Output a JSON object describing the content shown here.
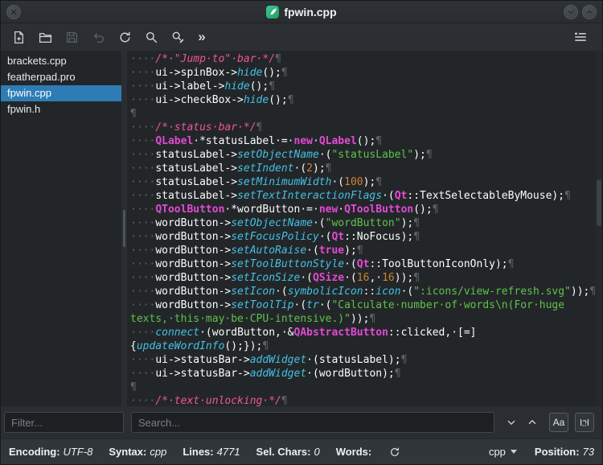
{
  "window": {
    "title": "fpwin.cpp"
  },
  "toolbar": {
    "overflow_label": "»"
  },
  "sidebar": {
    "files": [
      "brackets.cpp",
      "featherpad.pro",
      "fpwin.cpp",
      "fpwin.h"
    ],
    "selected_index": 2,
    "filter_placeholder": "Filter..."
  },
  "search": {
    "placeholder": "Search...",
    "match_case_label": "Aa"
  },
  "statusbar": {
    "encoding_label": "Encoding:",
    "encoding_value": "UTF-8",
    "syntax_label": "Syntax:",
    "syntax_value": "cpp",
    "lines_label": "Lines:",
    "lines_value": "4771",
    "sel_chars_label": "Sel. Chars:",
    "sel_chars_value": "0",
    "words_label": "Words:",
    "syntax_selector_value": "cpp",
    "position_label": "Position:",
    "position_value": "73"
  },
  "colors": {
    "selection_blue": "#2d7cb5",
    "comment": "#f0559d",
    "keyword": "#e24ad2",
    "function": "#44c0e2",
    "string": "#5fc24c",
    "number": "#cd8135",
    "editor_bg": "#232629"
  },
  "editor": {
    "lines": [
      [
        {
          "t": "····",
          "c": "ws"
        },
        {
          "t": "/*·\"Jump·to\"·bar·*/",
          "c": "com"
        },
        {
          "t": "¶",
          "c": "ws"
        }
      ],
      [
        {
          "t": "····",
          "c": "ws"
        },
        {
          "t": "ui->spinBox->",
          "c": "p"
        },
        {
          "t": "hide",
          "c": "fn"
        },
        {
          "t": "();",
          "c": "p"
        },
        {
          "t": "¶",
          "c": "ws"
        }
      ],
      [
        {
          "t": "····",
          "c": "ws"
        },
        {
          "t": "ui->label->",
          "c": "p"
        },
        {
          "t": "hide",
          "c": "fn"
        },
        {
          "t": "();",
          "c": "p"
        },
        {
          "t": "¶",
          "c": "ws"
        }
      ],
      [
        {
          "t": "····",
          "c": "ws"
        },
        {
          "t": "ui->checkBox->",
          "c": "p"
        },
        {
          "t": "hide",
          "c": "fn"
        },
        {
          "t": "();",
          "c": "p"
        },
        {
          "t": "¶",
          "c": "ws"
        }
      ],
      [
        {
          "t": "¶",
          "c": "ws"
        }
      ],
      [
        {
          "t": "····",
          "c": "ws"
        },
        {
          "t": "/*·status·bar·*/",
          "c": "com"
        },
        {
          "t": "¶",
          "c": "ws"
        }
      ],
      [
        {
          "t": "····",
          "c": "ws"
        },
        {
          "t": "QLabel",
          "c": "kw"
        },
        {
          "t": "·*statusLabel·=·",
          "c": "p"
        },
        {
          "t": "new",
          "c": "kw"
        },
        {
          "t": "·",
          "c": "p"
        },
        {
          "t": "QLabel",
          "c": "kw"
        },
        {
          "t": "();",
          "c": "p"
        },
        {
          "t": "¶",
          "c": "ws"
        }
      ],
      [
        {
          "t": "····",
          "c": "ws"
        },
        {
          "t": "statusLabel->",
          "c": "p"
        },
        {
          "t": "setObjectName",
          "c": "fn"
        },
        {
          "t": "·(",
          "c": "p"
        },
        {
          "t": "\"statusLabel\"",
          "c": "str"
        },
        {
          "t": ");",
          "c": "p"
        },
        {
          "t": "¶",
          "c": "ws"
        }
      ],
      [
        {
          "t": "····",
          "c": "ws"
        },
        {
          "t": "statusLabel->",
          "c": "p"
        },
        {
          "t": "setIndent",
          "c": "fn"
        },
        {
          "t": "·(",
          "c": "p"
        },
        {
          "t": "2",
          "c": "num"
        },
        {
          "t": ");",
          "c": "p"
        },
        {
          "t": "¶",
          "c": "ws"
        }
      ],
      [
        {
          "t": "····",
          "c": "ws"
        },
        {
          "t": "statusLabel->",
          "c": "p"
        },
        {
          "t": "setMinimumWidth",
          "c": "fn"
        },
        {
          "t": "·(",
          "c": "p"
        },
        {
          "t": "100",
          "c": "num"
        },
        {
          "t": ");",
          "c": "p"
        },
        {
          "t": "¶",
          "c": "ws"
        }
      ],
      [
        {
          "t": "····",
          "c": "ws"
        },
        {
          "t": "statusLabel->",
          "c": "p"
        },
        {
          "t": "setTextInteractionFlags",
          "c": "fn"
        },
        {
          "t": "·(",
          "c": "p"
        },
        {
          "t": "Qt",
          "c": "kw"
        },
        {
          "t": "::TextSelectableByMouse);",
          "c": "p"
        },
        {
          "t": "¶",
          "c": "ws"
        }
      ],
      [
        {
          "t": "····",
          "c": "ws"
        },
        {
          "t": "QToolButton",
          "c": "kw"
        },
        {
          "t": "·*wordButton·=·",
          "c": "p"
        },
        {
          "t": "new",
          "c": "kw"
        },
        {
          "t": "·",
          "c": "p"
        },
        {
          "t": "QToolButton",
          "c": "kw"
        },
        {
          "t": "();",
          "c": "p"
        },
        {
          "t": "¶",
          "c": "ws"
        }
      ],
      [
        {
          "t": "····",
          "c": "ws"
        },
        {
          "t": "wordButton->",
          "c": "p"
        },
        {
          "t": "setObjectName",
          "c": "fn"
        },
        {
          "t": "·(",
          "c": "p"
        },
        {
          "t": "\"wordButton\"",
          "c": "str"
        },
        {
          "t": ");",
          "c": "p"
        },
        {
          "t": "¶",
          "c": "ws"
        }
      ],
      [
        {
          "t": "····",
          "c": "ws"
        },
        {
          "t": "wordButton->",
          "c": "p"
        },
        {
          "t": "setFocusPolicy",
          "c": "fn"
        },
        {
          "t": "·(",
          "c": "p"
        },
        {
          "t": "Qt",
          "c": "kw"
        },
        {
          "t": "::NoFocus);",
          "c": "p"
        },
        {
          "t": "¶",
          "c": "ws"
        }
      ],
      [
        {
          "t": "····",
          "c": "ws"
        },
        {
          "t": "wordButton->",
          "c": "p"
        },
        {
          "t": "setAutoRaise",
          "c": "fn"
        },
        {
          "t": "·(",
          "c": "p"
        },
        {
          "t": "true",
          "c": "kw"
        },
        {
          "t": ");",
          "c": "p"
        },
        {
          "t": "¶",
          "c": "ws"
        }
      ],
      [
        {
          "t": "····",
          "c": "ws"
        },
        {
          "t": "wordButton->",
          "c": "p"
        },
        {
          "t": "setToolButtonStyle",
          "c": "fn"
        },
        {
          "t": "·(",
          "c": "p"
        },
        {
          "t": "Qt",
          "c": "kw"
        },
        {
          "t": "::ToolButtonIconOnly);",
          "c": "p"
        },
        {
          "t": "¶",
          "c": "ws"
        }
      ],
      [
        {
          "t": "····",
          "c": "ws"
        },
        {
          "t": "wordButton->",
          "c": "p"
        },
        {
          "t": "setIconSize",
          "c": "fn"
        },
        {
          "t": "·(",
          "c": "p"
        },
        {
          "t": "QSize",
          "c": "kw"
        },
        {
          "t": "·(",
          "c": "p"
        },
        {
          "t": "16",
          "c": "num"
        },
        {
          "t": ",·",
          "c": "p"
        },
        {
          "t": "16",
          "c": "num"
        },
        {
          "t": "));",
          "c": "p"
        },
        {
          "t": "¶",
          "c": "ws"
        }
      ],
      [
        {
          "t": "····",
          "c": "ws"
        },
        {
          "t": "wordButton->",
          "c": "p"
        },
        {
          "t": "setIcon",
          "c": "fn"
        },
        {
          "t": "·(",
          "c": "p"
        },
        {
          "t": "symbolicIcon",
          "c": "fn"
        },
        {
          "t": "::",
          "c": "p"
        },
        {
          "t": "icon",
          "c": "fn"
        },
        {
          "t": "·(",
          "c": "p"
        },
        {
          "t": "\":icons/view-refresh.svg\"",
          "c": "str"
        },
        {
          "t": "));",
          "c": "p"
        },
        {
          "t": "¶",
          "c": "ws"
        }
      ],
      [
        {
          "t": "····",
          "c": "ws"
        },
        {
          "t": "wordButton->",
          "c": "p"
        },
        {
          "t": "setToolTip",
          "c": "fn"
        },
        {
          "t": "·(",
          "c": "p"
        },
        {
          "t": "tr",
          "c": "fn"
        },
        {
          "t": "·(",
          "c": "p"
        },
        {
          "t": "\"Calculate·number·of·words\\n(For·huge",
          "c": "str"
        }
      ],
      [
        {
          "t": "texts,·this·may·be·CPU-intensive.)\"",
          "c": "str"
        },
        {
          "t": "));",
          "c": "p"
        },
        {
          "t": "¶",
          "c": "ws"
        }
      ],
      [
        {
          "t": "····",
          "c": "ws"
        },
        {
          "t": "connect",
          "c": "fn"
        },
        {
          "t": "·(wordButton,·&",
          "c": "p"
        },
        {
          "t": "QAbstractButton",
          "c": "kw"
        },
        {
          "t": "::clicked,·[=]",
          "c": "p"
        }
      ],
      [
        {
          "t": "{",
          "c": "p"
        },
        {
          "t": "updateWordInfo",
          "c": "fn"
        },
        {
          "t": "();});",
          "c": "p"
        },
        {
          "t": "¶",
          "c": "ws"
        }
      ],
      [
        {
          "t": "····",
          "c": "ws"
        },
        {
          "t": "ui->statusBar->",
          "c": "p"
        },
        {
          "t": "addWidget",
          "c": "fn"
        },
        {
          "t": "·(statusLabel);",
          "c": "p"
        },
        {
          "t": "¶",
          "c": "ws"
        }
      ],
      [
        {
          "t": "····",
          "c": "ws"
        },
        {
          "t": "ui->statusBar->",
          "c": "p"
        },
        {
          "t": "addWidget",
          "c": "fn"
        },
        {
          "t": "·(wordButton);",
          "c": "p"
        },
        {
          "t": "¶",
          "c": "ws"
        }
      ],
      [
        {
          "t": "¶",
          "c": "ws"
        }
      ],
      [
        {
          "t": "····",
          "c": "ws"
        },
        {
          "t": "/*·text·unlocking·*/",
          "c": "com"
        },
        {
          "t": "¶",
          "c": "ws"
        }
      ]
    ]
  }
}
